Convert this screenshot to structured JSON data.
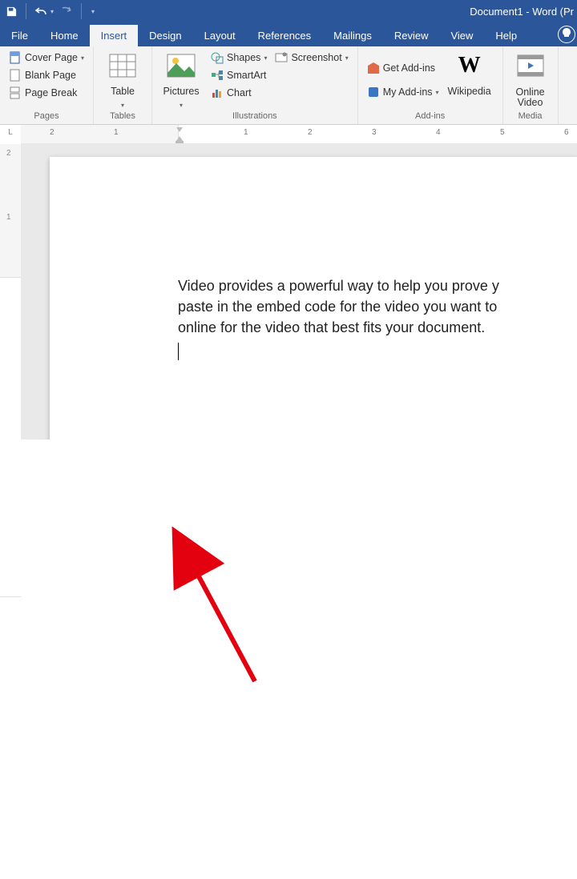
{
  "title": "Document1 - Word (Pr",
  "tabs": [
    "File",
    "Home",
    "Insert",
    "Design",
    "Layout",
    "References",
    "Mailings",
    "Review",
    "View",
    "Help"
  ],
  "active_tab": "Insert",
  "ribbon": {
    "pages": {
      "label": "Pages",
      "cover_page": "Cover Page",
      "blank_page": "Blank Page",
      "page_break": "Page Break"
    },
    "tables": {
      "label": "Tables",
      "table": "Table"
    },
    "illustrations": {
      "label": "Illustrations",
      "pictures": "Pictures",
      "shapes": "Shapes",
      "smartart": "SmartArt",
      "chart": "Chart",
      "screenshot": "Screenshot"
    },
    "addins": {
      "label": "Add-ins",
      "get": "Get Add-ins",
      "my": "My Add-ins",
      "wikipedia": "Wikipedia"
    },
    "media": {
      "label": "Media",
      "online_video_l1": "Online",
      "online_video_l2": "Video"
    }
  },
  "ruler": {
    "corner": "L",
    "nums": [
      "2",
      "1",
      "1",
      "2",
      "3",
      "4",
      "5",
      "6"
    ]
  },
  "vruler": {
    "nums": [
      "2",
      "1"
    ]
  },
  "body_lines": [
    "Video provides a powerful way to help you prove y",
    "paste in the embed code for the video you want to",
    "online for the video that best fits your document."
  ]
}
